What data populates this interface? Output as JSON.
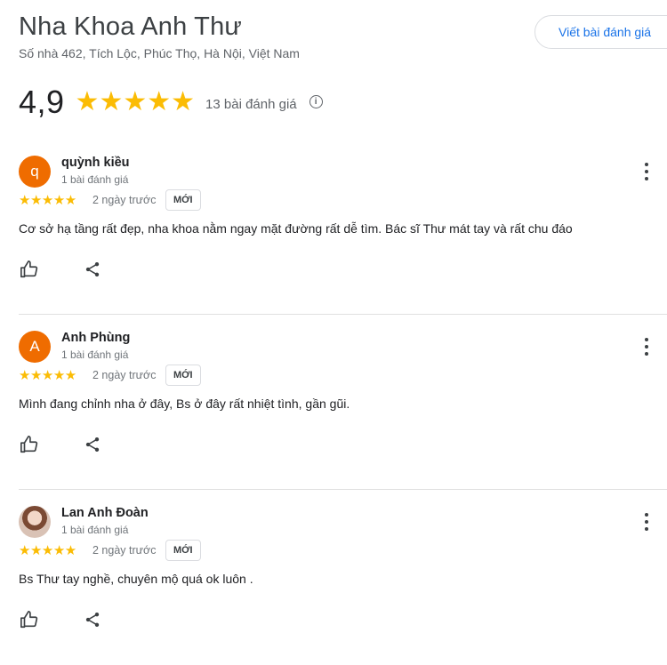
{
  "header": {
    "title": "Nha Khoa Anh Thư",
    "address": "Số nhà 462, Tích Lộc, Phúc Thọ, Hà Nội, Việt Nam",
    "write_review_label": "Viết bài đánh giá"
  },
  "summary": {
    "rating": "4,9",
    "stars": "★★★★★",
    "review_count": "13 bài đánh giá",
    "info_glyph": "i"
  },
  "reviews": [
    {
      "initial": "q",
      "name": "quỳnh kiều",
      "meta": "1 bài đánh giá",
      "stars": "★★★★★",
      "date": "2 ngày trước",
      "badge": "MỚI",
      "text": "Cơ sở hạ tầng rất đẹp, nha khoa nằm ngay mặt đường rất dễ tìm. Bác sĩ Thư mát tay và rất chu đáo"
    },
    {
      "initial": "A",
      "name": "Anh Phùng",
      "meta": "1 bài đánh giá",
      "stars": "★★★★★",
      "date": "2 ngày trước",
      "badge": "MỚI",
      "text": "Mình đang chỉnh nha ở đây, Bs ở đây rất nhiệt tình, gần gũi."
    },
    {
      "initial": "",
      "name": "Lan Anh Đoàn",
      "meta": "1 bài đánh giá",
      "stars": "★★★★★",
      "date": "2 ngày trước",
      "badge": "MỚI",
      "text": "Bs Thư tay nghề, chuyên mộ quá ok luôn ."
    }
  ],
  "colors": {
    "accent": "#1a73e8",
    "star": "#fbbc04",
    "avatar_orange": "#ef6c00"
  },
  "icons": [
    "more-vert-icon",
    "thumb-up-icon",
    "share-icon",
    "info-icon"
  ]
}
